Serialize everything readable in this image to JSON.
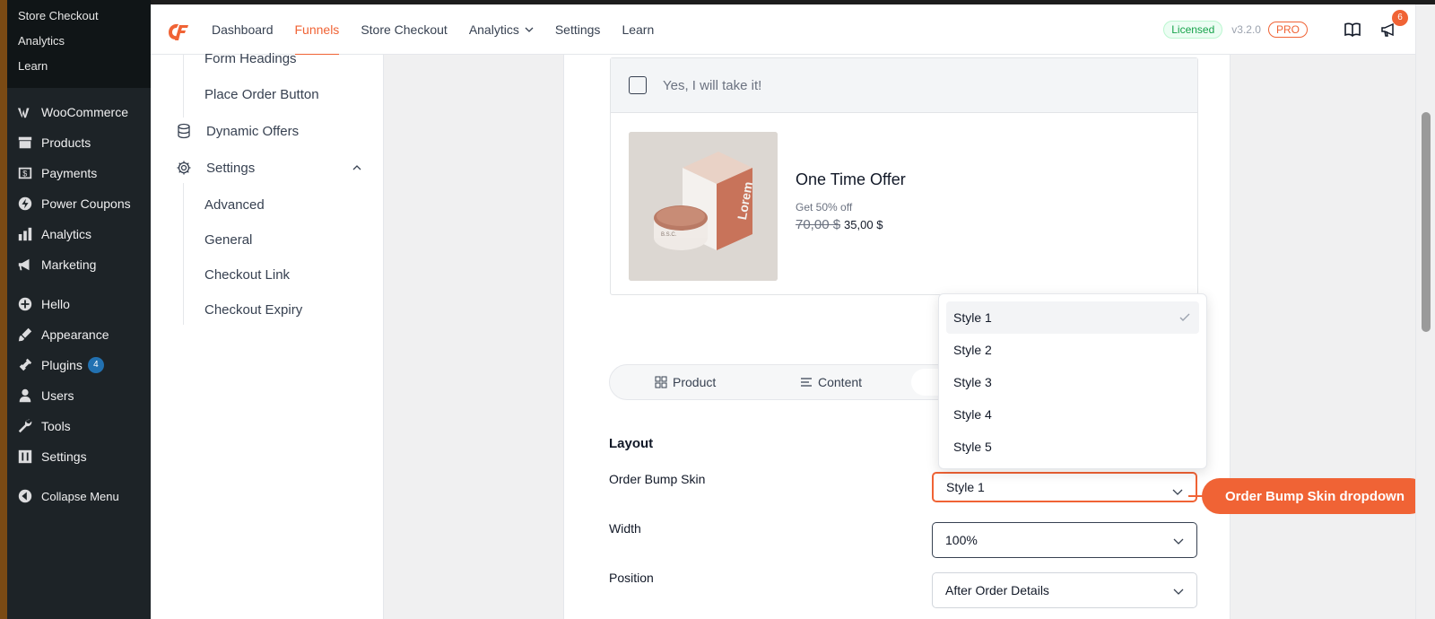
{
  "wp_sidebar": {
    "submenu": [
      "Store Checkout",
      "Analytics",
      "Learn"
    ],
    "items": [
      {
        "label": "WooCommerce",
        "icon": "woocommerce-icon"
      },
      {
        "label": "Products",
        "icon": "archive-icon"
      },
      {
        "label": "Payments",
        "icon": "dollar-card-icon"
      },
      {
        "label": "Power Coupons",
        "icon": "power-coupons-icon"
      },
      {
        "label": "Analytics",
        "icon": "bar-chart-icon"
      },
      {
        "label": "Marketing",
        "icon": "megaphone-icon"
      },
      {
        "label": "Hello",
        "icon": "plus-circle-icon"
      },
      {
        "label": "Appearance",
        "icon": "paintbrush-icon"
      },
      {
        "label": "Plugins",
        "icon": "plug-icon",
        "badge": "4"
      },
      {
        "label": "Users",
        "icon": "user-icon"
      },
      {
        "label": "Tools",
        "icon": "wrench-icon"
      },
      {
        "label": "Settings",
        "icon": "sliders-icon"
      },
      {
        "label": "Collapse Menu",
        "icon": "collapse-arrow-icon"
      }
    ]
  },
  "topbar": {
    "nav": [
      "Dashboard",
      "Funnels",
      "Store Checkout",
      "Analytics",
      "Settings",
      "Learn"
    ],
    "active": "Funnels",
    "licensed": "Licensed",
    "version": "v3.2.0",
    "pro": "PRO",
    "notifications": "6",
    "accent": "#f06335"
  },
  "settings_nav": {
    "form_headings": "Form Headings",
    "place_order": "Place Order Button",
    "dynamic_offers": "Dynamic Offers",
    "settings": "Settings",
    "advanced": "Advanced",
    "general": "General",
    "checkout_link": "Checkout Link",
    "checkout_expiry": "Checkout Expiry"
  },
  "bump": {
    "checkbox_label": "Yes, I will take it!",
    "title": "One Time Offer",
    "description": "Get 50% off",
    "old_price": "70,00 $",
    "new_price": "35,00 $",
    "box_brand": "Lorem",
    "jar_label": "B.S.C."
  },
  "tabs": {
    "product": "Product",
    "content": "Content"
  },
  "layout": {
    "title": "Layout",
    "skin_label": "Order Bump Skin",
    "skin_value": "Style 1",
    "width_label": "Width",
    "width_value": "100%",
    "position_label": "Position",
    "position_value": "After Order Details"
  },
  "skin_menu": {
    "options": [
      "Style 1",
      "Style 2",
      "Style 3",
      "Style 4",
      "Style 5"
    ],
    "selected": "Style 1"
  },
  "annotation": {
    "label": "Order Bump Skin dropdown"
  }
}
